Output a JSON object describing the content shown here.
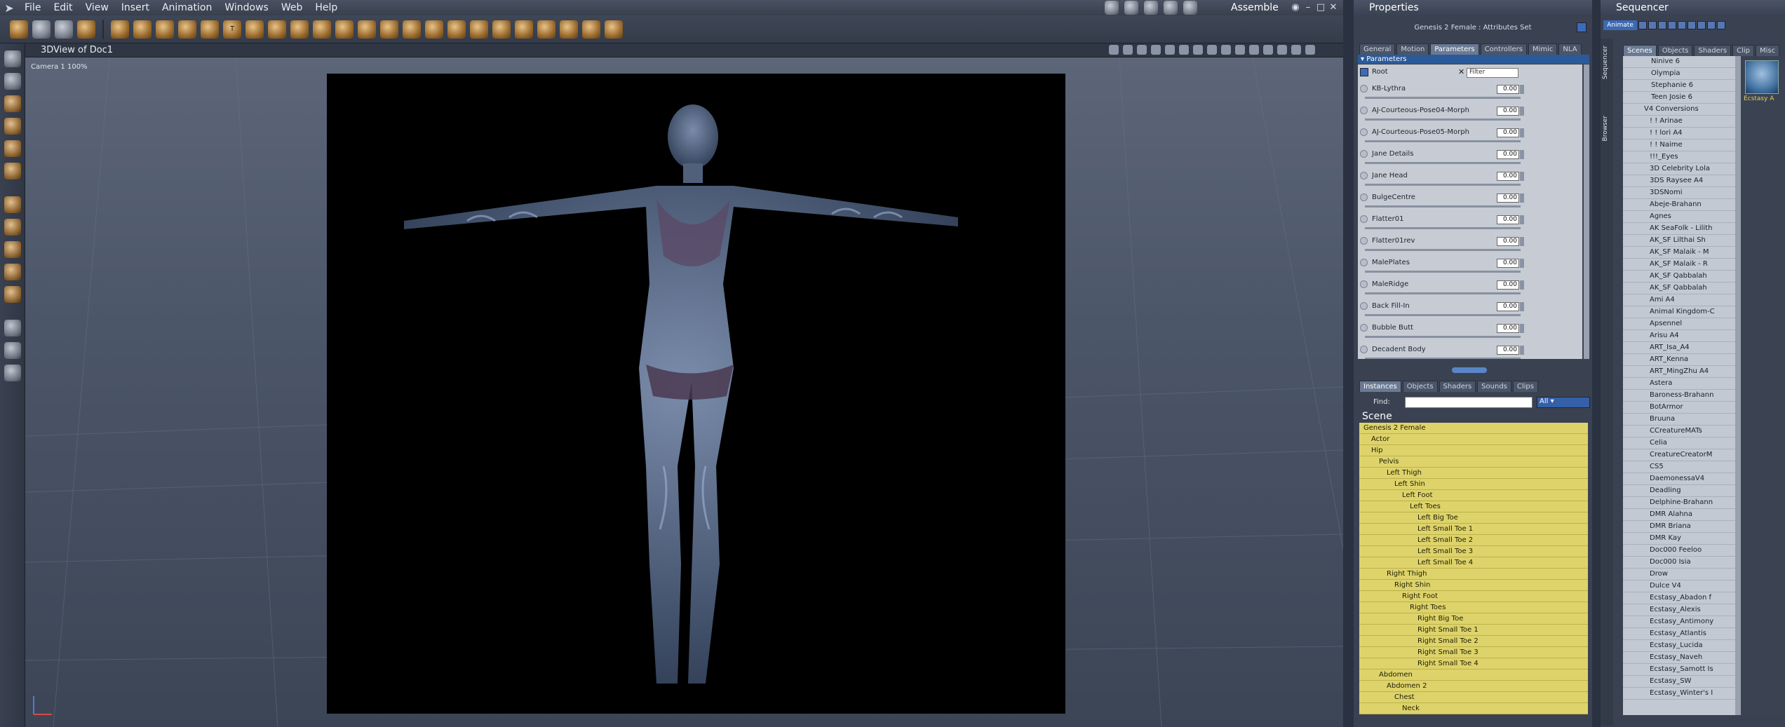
{
  "menubar": {
    "items": [
      "File",
      "Edit",
      "View",
      "Insert",
      "Animation",
      "Windows",
      "Web",
      "Help"
    ],
    "mode": "Assemble"
  },
  "view": {
    "title": "3DView of Doc1",
    "camera": "Camera 1 100%"
  },
  "properties": {
    "title": "Properties",
    "attribute_set": "Genesis 2 Female : Attributes Set",
    "tabs": [
      "General",
      "Motion",
      "Parameters",
      "Controllers",
      "Mimic",
      "NLA"
    ],
    "active_tab": "Parameters",
    "section": "Parameters",
    "root_label": "Root",
    "filter_placeholder": "Filter",
    "parameters": [
      {
        "name": "KB-Lythra",
        "value": "0.00"
      },
      {
        "name": "AJ-Courteous-Pose04-Morph",
        "value": "0.00"
      },
      {
        "name": "AJ-Courteous-Pose05-Morph",
        "value": "0.00"
      },
      {
        "name": "Jane Details",
        "value": "0.00"
      },
      {
        "name": "Jane Head",
        "value": "0.00"
      },
      {
        "name": "BulgeCentre",
        "value": "0.00"
      },
      {
        "name": "Flatter01",
        "value": "0.00"
      },
      {
        "name": "Flatter01rev",
        "value": "0.00"
      },
      {
        "name": "MalePlates",
        "value": "0.00"
      },
      {
        "name": "MaleRidge",
        "value": "0.00"
      },
      {
        "name": "Back Fill-In",
        "value": "0.00"
      },
      {
        "name": "Bubble Butt",
        "value": "0.00"
      },
      {
        "name": "Decadent Body",
        "value": "0.00"
      }
    ]
  },
  "instances": {
    "tabs": [
      "Instances",
      "Objects",
      "Shaders",
      "Sounds",
      "Clips"
    ],
    "find_label": "Find:",
    "filter_value": "All",
    "scene_label": "Scene",
    "tree": [
      {
        "label": "Genesis 2 Female",
        "depth": 0
      },
      {
        "label": "Actor",
        "depth": 1
      },
      {
        "label": "Hip",
        "depth": 1
      },
      {
        "label": "Pelvis",
        "depth": 2
      },
      {
        "label": "Left Thigh",
        "depth": 3
      },
      {
        "label": "Left Shin",
        "depth": 4
      },
      {
        "label": "Left Foot",
        "depth": 5
      },
      {
        "label": "Left Toes",
        "depth": 6
      },
      {
        "label": "Left Big Toe",
        "depth": 7
      },
      {
        "label": "Left Small Toe 1",
        "depth": 7
      },
      {
        "label": "Left Small Toe 2",
        "depth": 7
      },
      {
        "label": "Left Small Toe 3",
        "depth": 7
      },
      {
        "label": "Left Small Toe 4",
        "depth": 7
      },
      {
        "label": "Right Thigh",
        "depth": 3
      },
      {
        "label": "Right Shin",
        "depth": 4
      },
      {
        "label": "Right Foot",
        "depth": 5
      },
      {
        "label": "Right Toes",
        "depth": 6
      },
      {
        "label": "Right Big Toe",
        "depth": 7
      },
      {
        "label": "Right Small Toe 1",
        "depth": 7
      },
      {
        "label": "Right Small Toe 2",
        "depth": 7
      },
      {
        "label": "Right Small Toe 3",
        "depth": 7
      },
      {
        "label": "Right Small Toe 4",
        "depth": 7
      },
      {
        "label": "Abdomen",
        "depth": 2
      },
      {
        "label": "Abdomen 2",
        "depth": 3
      },
      {
        "label": "Chest",
        "depth": 4
      },
      {
        "label": "Neck",
        "depth": 5
      }
    ]
  },
  "sequencer": {
    "title": "Sequencer",
    "animate_label": "Animate",
    "side_tabs": [
      "Sequencer",
      "Browser"
    ],
    "tabs": [
      "Scenes",
      "Objects",
      "Shaders",
      "Clip",
      "Misc"
    ],
    "thumbnail_label": "Ecstasy A",
    "items": [
      "Ninive 6",
      "Olympia",
      "Stephanie 6",
      "Teen Josie 6",
      "V4 Conversions",
      "! ! Arinae",
      "! ! lori A4",
      "! ! Naime",
      "!!!_Eyes",
      "3D Celebrity Lola",
      "3DS Raysee A4",
      "3DSNomi",
      "Abeje-Brahann",
      "Agnes",
      "AK SeaFolk - Lilith",
      "AK_SF Lilthai Sh",
      "AK_SF Malaik - M",
      "AK_SF Malaik - R",
      "AK_SF Qabbalah",
      "AK_SF Qabbalah",
      "Ami A4",
      "Animal Kingdom-C",
      "Apsennel",
      "Arisu A4",
      "ART_Isa_A4",
      "ART_Kenna",
      "ART_MingZhu A4",
      "Astera",
      "Baroness-Brahann",
      "BotArmor",
      "Bruuna",
      "CCreatureMATs",
      "Celia",
      "CreatureCreatorM",
      "CS5",
      "DaemonessaV4",
      "Deadling",
      "Delphine-Brahann",
      "DMR Alahna",
      "DMR Briana",
      "DMR Kay",
      "Doc000 Feeloo",
      "Doc000 Isia",
      "Drow",
      "Dulce V4",
      "Ecstasy_Abadon f",
      "Ecstasy_Alexis",
      "Ecstasy_Antimony",
      "Ecstasy_Atlantis",
      "Ecstasy_Lucida",
      "Ecstasy_Naveh",
      "Ecstasy_Samott Is",
      "Ecstasy_SW",
      "Ecstasy_Winter's I"
    ]
  }
}
